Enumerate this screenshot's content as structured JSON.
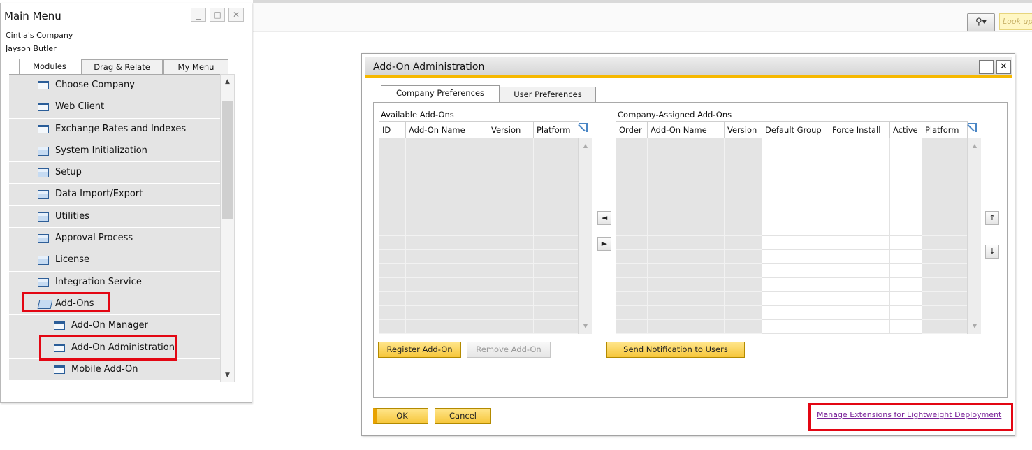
{
  "toolbar": {
    "search_icon": "magnifier-icon",
    "search_dropdown": "▾",
    "lookup_placeholder": "Look up"
  },
  "main_menu": {
    "title": "Main Menu",
    "company": "Cintia's Company",
    "user": "Jayson Butler",
    "window_buttons": [
      "_",
      "□",
      "✕"
    ],
    "tabs": [
      "Modules",
      "Drag & Relate",
      "My Menu"
    ],
    "items": [
      {
        "label": "Choose Company",
        "icon": "window-icon"
      },
      {
        "label": "Web Client",
        "icon": "window-icon"
      },
      {
        "label": "Exchange Rates and Indexes",
        "icon": "window-icon"
      },
      {
        "label": "System Initialization",
        "icon": "folder-icon"
      },
      {
        "label": "Setup",
        "icon": "folder-icon"
      },
      {
        "label": "Data Import/Export",
        "icon": "folder-icon"
      },
      {
        "label": "Utilities",
        "icon": "folder-icon"
      },
      {
        "label": "Approval Process",
        "icon": "folder-icon"
      },
      {
        "label": "License",
        "icon": "folder-icon"
      },
      {
        "label": "Integration Service",
        "icon": "folder-icon"
      },
      {
        "label": "Add-Ons",
        "icon": "folder-open-icon"
      },
      {
        "label": "Add-On Manager",
        "icon": "window-icon"
      },
      {
        "label": "Add-On Administration",
        "icon": "window-icon"
      },
      {
        "label": "Mobile Add-On",
        "icon": "window-icon"
      }
    ]
  },
  "addon_admin": {
    "title": "Add-On Administration",
    "min_glyph": "_",
    "close_glyph": "✕",
    "tabs": [
      "Company Preferences",
      "User Preferences"
    ],
    "available": {
      "label": "Available Add-Ons",
      "columns": [
        "ID",
        "Add-On Name",
        "Version",
        "Platform"
      ]
    },
    "assigned": {
      "label": "Company-Assigned Add-Ons",
      "columns": [
        "Order",
        "Add-On Name",
        "Version",
        "Default Group",
        "Force Install",
        "Active",
        "Platform"
      ]
    },
    "move_left": "◄",
    "move_right": "►",
    "move_up": "↑",
    "move_down": "↓",
    "buttons": {
      "register": "Register Add-On",
      "remove": "Remove Add-On",
      "send_notification": "Send Notification to Users",
      "ok": "OK",
      "cancel": "Cancel"
    },
    "manage_link": "Manage Extensions for Lightweight Deployment"
  }
}
